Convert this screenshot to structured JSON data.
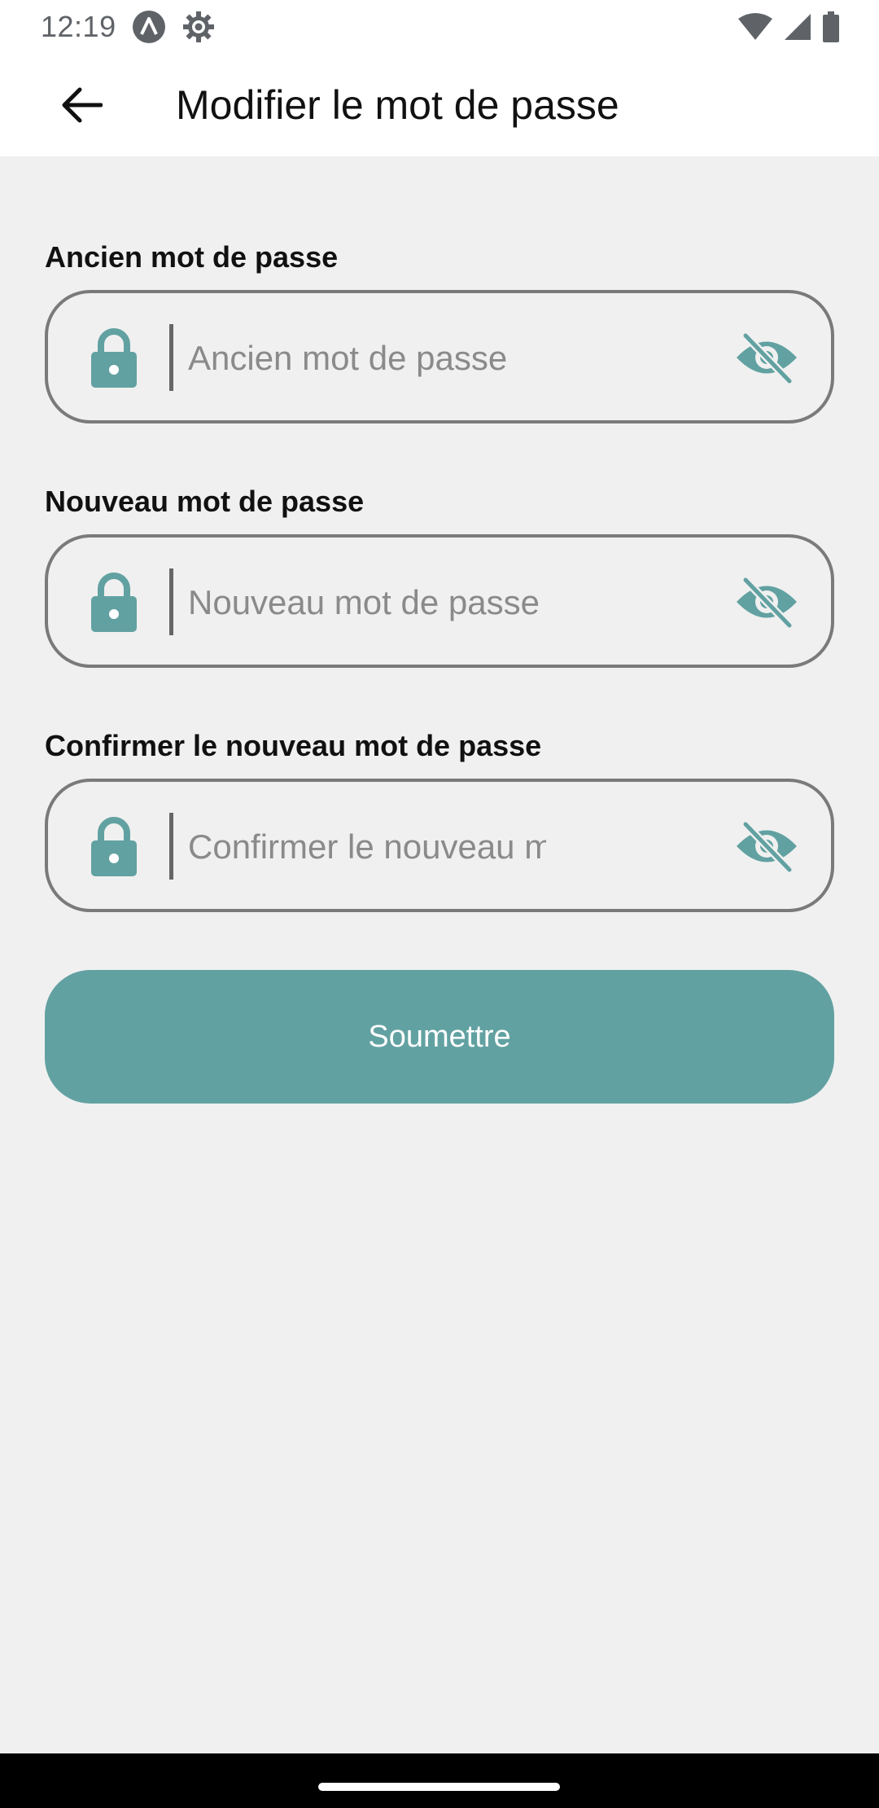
{
  "status_bar": {
    "time": "12:19",
    "left_icons": [
      "app-a-icon",
      "settings-gear-icon"
    ],
    "right_icons": [
      "wifi-icon",
      "cell-signal-icon",
      "battery-icon"
    ]
  },
  "app_bar": {
    "back_icon": "arrow-back-icon",
    "title": "Modifier le mot de passe"
  },
  "form": {
    "fields": [
      {
        "label": "Ancien mot de passe",
        "placeholder": "Ancien mot de passe",
        "value": "",
        "leading_icon": "lock-icon",
        "trailing_icon": "eye-off-icon"
      },
      {
        "label": "Nouveau mot de passe",
        "placeholder": "Nouveau mot de passe",
        "value": "",
        "leading_icon": "lock-icon",
        "trailing_icon": "eye-off-icon"
      },
      {
        "label": "Confirmer le nouveau mot de passe",
        "placeholder": "Confirmer le nouveau mot de passe",
        "value": "",
        "leading_icon": "lock-icon",
        "trailing_icon": "eye-off-icon"
      }
    ],
    "submit_label": "Soumettre"
  },
  "colors": {
    "accent": "#62a1a1",
    "background": "#f0f0f0",
    "field_border": "#7a7a7a"
  }
}
